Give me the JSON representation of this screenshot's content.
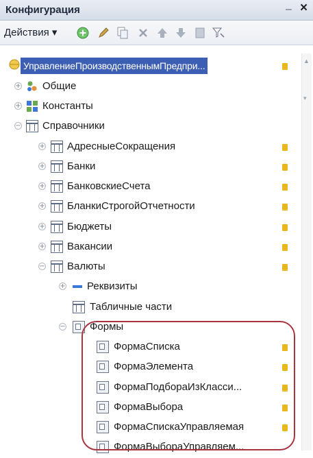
{
  "window": {
    "title": "Конфигурация",
    "minimize_glyph": "–",
    "close_glyph": "×"
  },
  "toolbar": {
    "actions_label": "Действия ▾",
    "buttons": [
      "add-icon",
      "edit-icon",
      "copy-icon",
      "delete-icon",
      "move-up-icon",
      "move-down-icon",
      "sort-icon",
      "filter-icon"
    ]
  },
  "tree": {
    "root": "УправлениеПроизводственнымПредпри...",
    "common": "Общие",
    "constants": "Константы",
    "catalogs": "Справочники",
    "catalog_items": [
      "АдресныеСокращения",
      "Банки",
      "БанковскиеСчета",
      "БланкиСтрогойОтчетности",
      "Бюджеты",
      "Вакансии",
      "Валюты"
    ],
    "currency_children": {
      "attributes": "Реквизиты",
      "tabular_sections": "Табличные части",
      "forms": "Формы"
    },
    "forms": [
      "ФормаСписка",
      "ФормаЭлемента",
      "ФормаПодбораИзКласси...",
      "ФормаВыбора",
      "ФормаСпискаУправляемая",
      "ФормаВыбораУправляем..."
    ]
  },
  "colors": {
    "selection": "#3c5fb4",
    "highlight_outline": "#a7343f",
    "flag": "#e9b820"
  }
}
